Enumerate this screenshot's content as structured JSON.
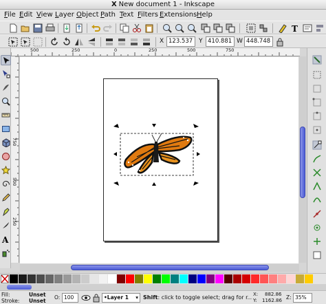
{
  "window": {
    "title": "New document 1 - Inkscape",
    "app_glyph": "X"
  },
  "menu": [
    "File",
    "Edit",
    "View",
    "Layer",
    "Object",
    "Path",
    "Text",
    "Filters",
    "Extensions",
    "Help"
  ],
  "coords": {
    "x_label": "X",
    "x_value": "123.537",
    "y_label": "Y",
    "y_value": "410.881",
    "w_label": "W",
    "w_value": "448.748"
  },
  "ruler_top": [
    "500",
    "250",
    "0",
    "250",
    "500",
    "750"
  ],
  "ruler_left": [
    "750",
    "500",
    "250"
  ],
  "toolbox": {
    "tools": [
      "selector-icon",
      "node-icon",
      "tweak-icon",
      "zoom-icon",
      "measure-icon",
      "rect-icon",
      "3dbox-icon",
      "ellipse-icon",
      "star-icon",
      "spiral-icon",
      "pencil-icon",
      "pen-icon",
      "calligraphy-icon",
      "text-icon",
      "spray-icon"
    ],
    "active": "selector-icon"
  },
  "palette": {
    "colors": [
      "#000000",
      "#1a1a1a",
      "#333333",
      "#4d4d4d",
      "#666666",
      "#808080",
      "#999999",
      "#b3b3b3",
      "#cccccc",
      "#e6e6e6",
      "#f2f2f2",
      "#ffffff",
      "#800000",
      "#ff0000",
      "#808000",
      "#ffff00",
      "#008000",
      "#00ff00",
      "#008080",
      "#00ffff",
      "#000080",
      "#0000ff",
      "#800080",
      "#ff00ff",
      "#550000",
      "#aa0000",
      "#d40000",
      "#ff2a2a",
      "#ff5555",
      "#ff8080",
      "#ffaaaa",
      "#ffd5d5",
      "#c8ab37",
      "#ffcc00"
    ]
  },
  "status": {
    "fill_label": "Fill:",
    "fill_value": "Unset",
    "stroke_label": "Stroke:",
    "stroke_value": "Unset",
    "opacity_label": "O:",
    "opacity_value": "100",
    "layer_name": "•Layer 1",
    "message_bold": "Shift",
    "message_rest": ": click to toggle select; drag for r...",
    "x_label": "X:",
    "x_value": "882.86",
    "y_label": "Y:",
    "y_value": "1162.86",
    "z_label": "Z:",
    "zoom_value": "35%"
  }
}
